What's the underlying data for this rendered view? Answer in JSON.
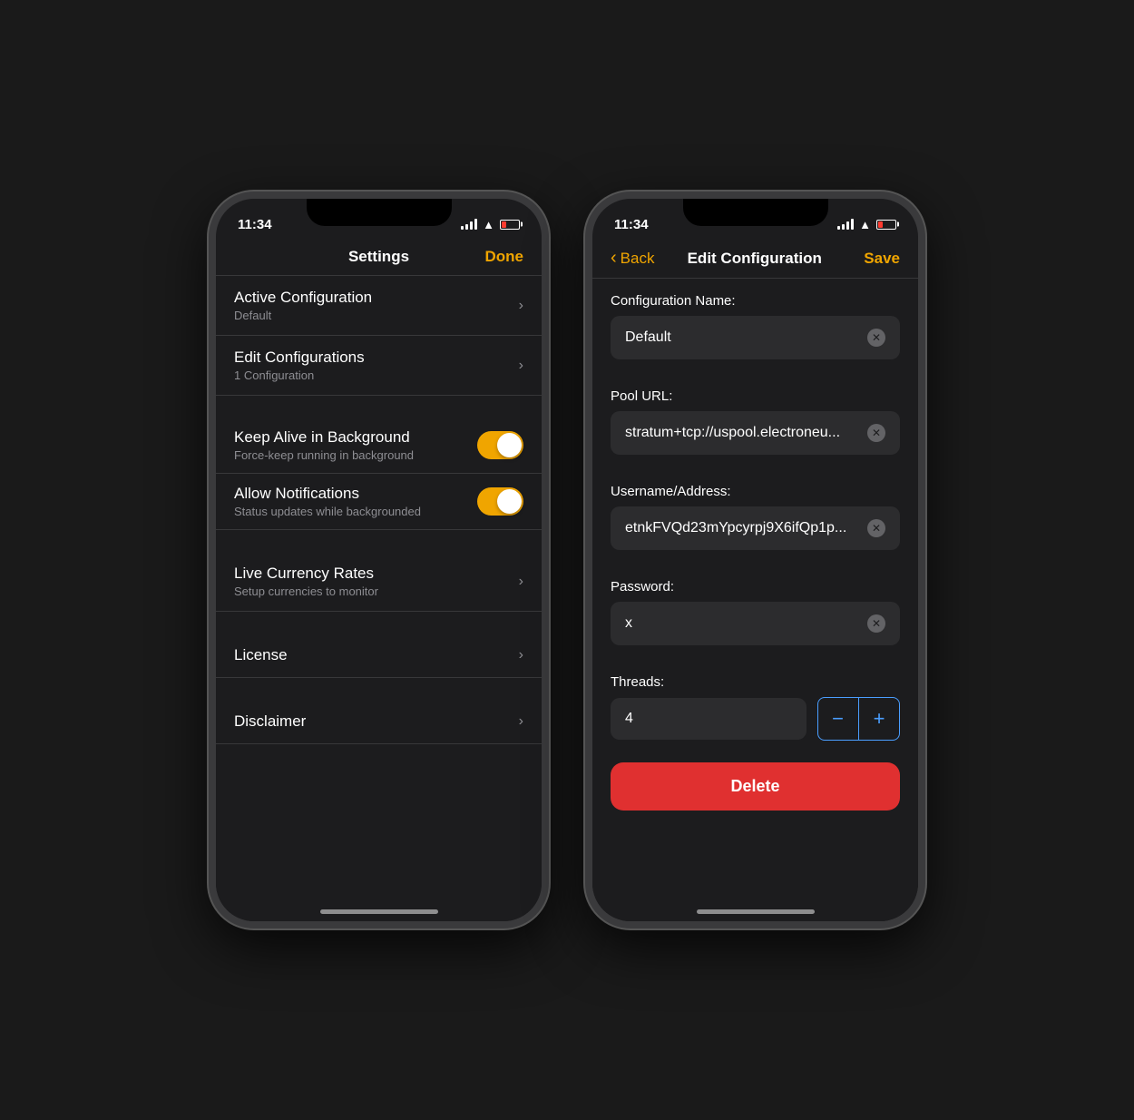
{
  "phone1": {
    "status": {
      "time": "11:34",
      "signal_bars": [
        4,
        6,
        8,
        10,
        12
      ],
      "battery_color": "#ff3b30"
    },
    "nav": {
      "title": "Settings",
      "right_btn": "Done"
    },
    "items": [
      {
        "title": "Active Configuration",
        "subtitle": "Default",
        "has_chevron": true
      },
      {
        "title": "Edit Configurations",
        "subtitle": "1 Configuration",
        "has_chevron": true
      }
    ],
    "toggles": [
      {
        "title": "Keep Alive in Background",
        "subtitle": "Force-keep running in background",
        "enabled": true
      },
      {
        "title": "Allow Notifications",
        "subtitle": "Status updates while backgrounded",
        "enabled": true
      }
    ],
    "bottom_items": [
      {
        "title": "Live Currency Rates",
        "subtitle": "Setup currencies to monitor",
        "has_chevron": true
      },
      {
        "title": "License",
        "subtitle": "",
        "has_chevron": true
      },
      {
        "title": "Disclaimer",
        "subtitle": "",
        "has_chevron": true
      }
    ]
  },
  "phone2": {
    "status": {
      "time": "11:34"
    },
    "nav": {
      "back_label": "Back",
      "title": "Edit Configuration",
      "right_btn": "Save"
    },
    "form": {
      "config_name_label": "Configuration Name:",
      "config_name_value": "Default",
      "pool_url_label": "Pool URL:",
      "pool_url_value": "stratum+tcp://uspool.electroneu...",
      "username_label": "Username/Address:",
      "username_value": "etnkFVQd23mYpcyrpj9X6ifQp1p...",
      "password_label": "Password:",
      "password_value": "x",
      "threads_label": "Threads:",
      "threads_value": "4"
    },
    "stepper": {
      "minus": "−",
      "plus": "+"
    },
    "delete_btn": "Delete"
  }
}
